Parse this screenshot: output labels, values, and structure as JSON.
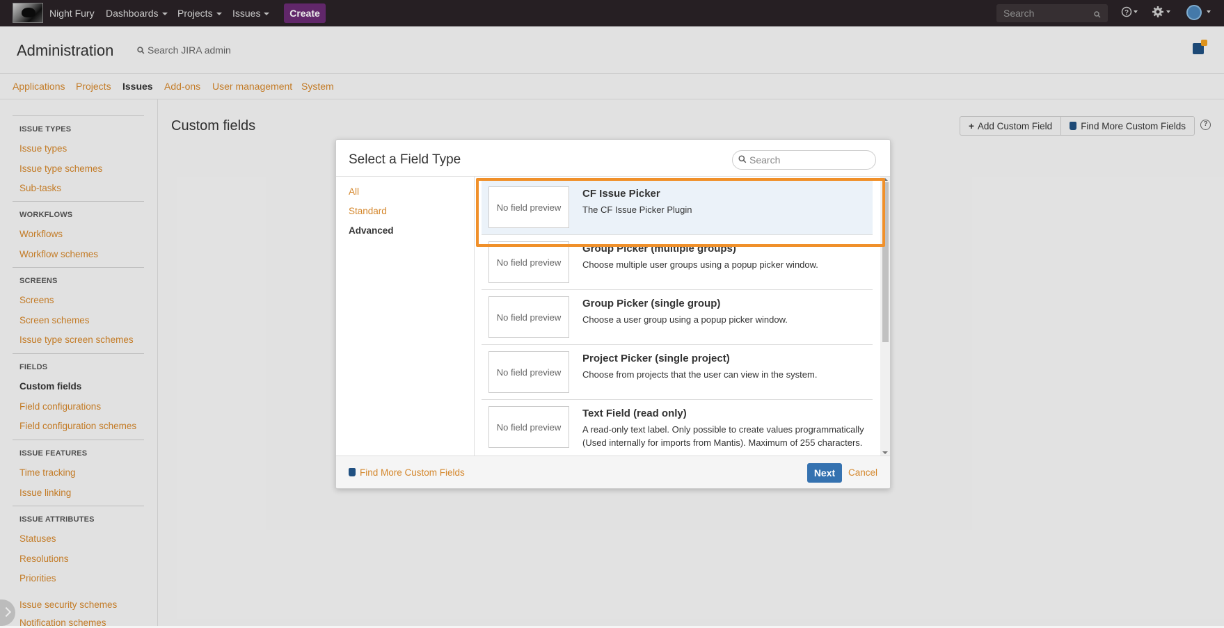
{
  "topnav": {
    "site_name": "Night Fury",
    "menus": [
      "Dashboards",
      "Projects",
      "Issues"
    ],
    "create_label": "Create",
    "search_placeholder": "Search"
  },
  "admin": {
    "title": "Administration",
    "search_label": "Search JIRA admin",
    "tabs": [
      "Applications",
      "Projects",
      "Issues",
      "Add-ons",
      "User management",
      "System"
    ],
    "active_tab": "Issues"
  },
  "sidebar": {
    "sections": [
      {
        "heading": "ISSUE TYPES",
        "items": [
          "Issue types",
          "Issue type schemes",
          "Sub-tasks"
        ]
      },
      {
        "heading": "WORKFLOWS",
        "items": [
          "Workflows",
          "Workflow schemes"
        ]
      },
      {
        "heading": "SCREENS",
        "items": [
          "Screens",
          "Screen schemes",
          "Issue type screen schemes"
        ]
      },
      {
        "heading": "FIELDS",
        "items": [
          "Custom fields",
          "Field configurations",
          "Field configuration schemes"
        ]
      },
      {
        "heading": "ISSUE FEATURES",
        "items": [
          "Time tracking",
          "Issue linking"
        ]
      },
      {
        "heading": "ISSUE ATTRIBUTES",
        "items": [
          "Statuses",
          "Resolutions",
          "Priorities",
          "Issue security schemes",
          "Notification schemes"
        ]
      }
    ],
    "active_item": "Custom fields"
  },
  "main": {
    "title": "Custom fields",
    "add_button": "Add Custom Field",
    "find_more_button": "Find More Custom Fields"
  },
  "dialog": {
    "title": "Select a Field Type",
    "search_placeholder": "Search",
    "categories": [
      "All",
      "Standard",
      "Advanced"
    ],
    "active_category": "Advanced",
    "items": [
      {
        "title": "CF Issue Picker",
        "description": "The CF Issue Picker Plugin",
        "preview": "No field preview",
        "selected": true
      },
      {
        "title": "Group Picker (multiple groups)",
        "description": "Choose multiple user groups using a popup picker window.",
        "preview": "No field preview"
      },
      {
        "title": "Group Picker (single group)",
        "description": "Choose a user group using a popup picker window.",
        "preview": "No field preview"
      },
      {
        "title": "Project Picker (single project)",
        "description": "Choose from projects that the user can view in the system.",
        "preview": "No field preview"
      },
      {
        "title": "Text Field (read only)",
        "description": "A read-only text label. Only possible to create values programmatically (Used internally for imports from Mantis). Maximum of 255 characters.",
        "preview": "No field preview"
      }
    ],
    "footer_link": "Find More Custom Fields",
    "next_label": "Next",
    "cancel_label": "Cancel"
  },
  "colors": {
    "topbar": "#2a2226",
    "create": "#6a2b73",
    "link": "#d4862a",
    "primary_button": "#3572b0",
    "highlight": "#f0902a",
    "selected_row": "#ebf2f9"
  }
}
